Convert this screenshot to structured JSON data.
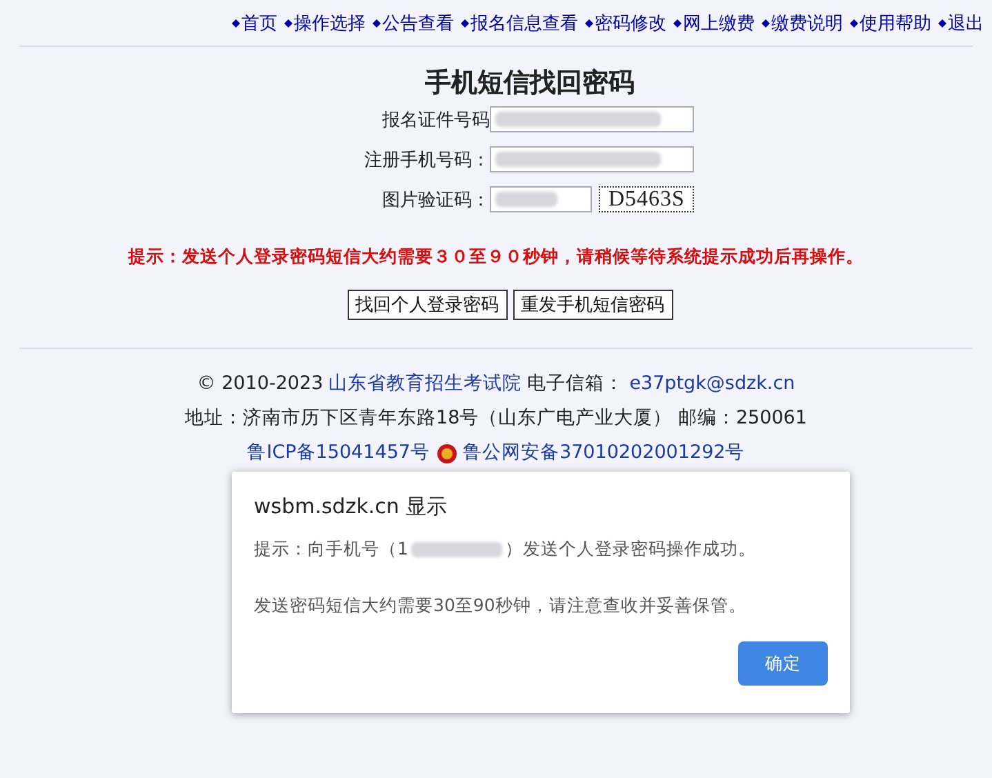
{
  "nav": [
    {
      "label": "首页"
    },
    {
      "label": "操作选择"
    },
    {
      "label": "公告查看"
    },
    {
      "label": "报名信息查看"
    },
    {
      "label": "密码修改"
    },
    {
      "label": "网上缴费"
    },
    {
      "label": "缴费说明"
    },
    {
      "label": "使用帮助"
    },
    {
      "label": "退出"
    }
  ],
  "title": "手机短信找回密码",
  "form": [
    {
      "label": "报名证件号码",
      "kind": "text"
    },
    {
      "label": "注册手机号码：",
      "kind": "text"
    },
    {
      "label": "图片验证码：",
      "kind": "captcha",
      "captcha": "D5463S"
    }
  ],
  "notice": "提示：发送个人登录密码短信大约需要３０至９０秒钟，请稍候等待系统提示成功后再操作。",
  "buttons": [
    "找回个人登录密码",
    "重发手机短信密码"
  ],
  "footer": {
    "copyright": "© 2010-2023",
    "org": "山东省教育招生考试院",
    "email_label": "电子信箱：",
    "email": "e37ptgk@sdzk.cn",
    "address": "地址：济南市历下区青年东路18号（山东广电产业大厦） 邮编：250061",
    "icp": "鲁ICP备15041457号",
    "police": "鲁公网安备37010202001292号"
  },
  "dialog": {
    "title": "wsbm.sdzk.cn 显示",
    "message_before": "提示：向手机号（1",
    "message_after": "）发送个人登录密码操作成功。",
    "message2": "发送密码短信大约需要30至90秒钟，请注意查收并妥善保管。",
    "ok": "确定"
  }
}
